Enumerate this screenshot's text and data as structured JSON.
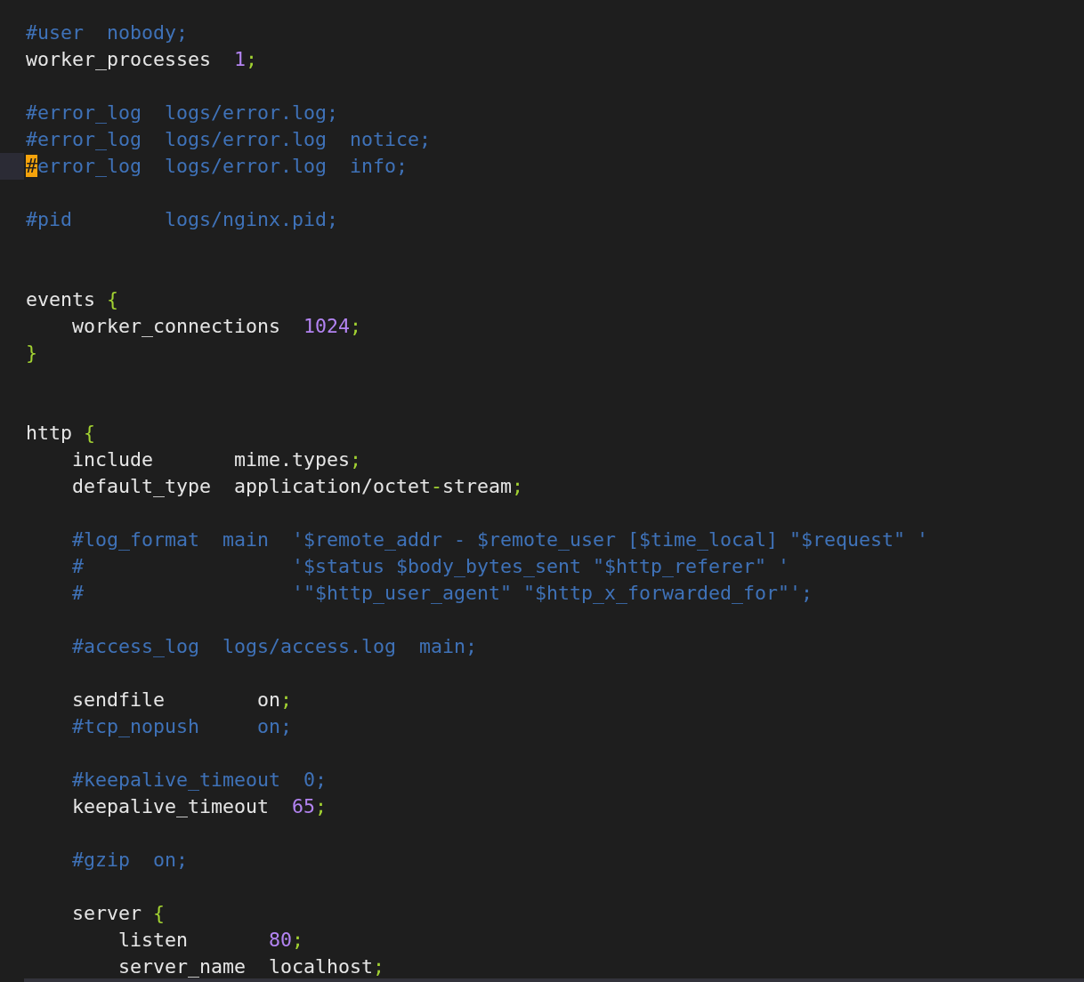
{
  "editor": {
    "lines": [
      {
        "current": false,
        "segments": [
          {
            "kind": "comment",
            "text": "#user  nobody;"
          }
        ]
      },
      {
        "current": false,
        "segments": [
          {
            "kind": "plain",
            "text": "worker_processes  "
          },
          {
            "kind": "number",
            "text": "1"
          },
          {
            "kind": "punct",
            "text": ";"
          }
        ]
      },
      {
        "current": false
      },
      {
        "current": false,
        "segments": [
          {
            "kind": "comment",
            "text": "#error_log  logs/error.log;"
          }
        ]
      },
      {
        "current": false,
        "segments": [
          {
            "kind": "comment",
            "text": "#error_log  logs/error.log  notice;"
          }
        ]
      },
      {
        "current": true,
        "segments": [
          {
            "kind": "cursor",
            "text": "#"
          },
          {
            "kind": "comment",
            "text": "error_log  logs/error.log  info;"
          }
        ]
      },
      {
        "current": false
      },
      {
        "current": false,
        "segments": [
          {
            "kind": "comment",
            "text": "#pid        logs/nginx.pid;"
          }
        ]
      },
      {
        "current": false
      },
      {
        "current": false
      },
      {
        "current": false,
        "segments": [
          {
            "kind": "plain",
            "text": "events "
          },
          {
            "kind": "punct",
            "text": "{"
          }
        ]
      },
      {
        "current": false,
        "segments": [
          {
            "kind": "plain",
            "text": "    worker_connections  "
          },
          {
            "kind": "number",
            "text": "1024"
          },
          {
            "kind": "punct",
            "text": ";"
          }
        ]
      },
      {
        "current": false,
        "segments": [
          {
            "kind": "punct",
            "text": "}"
          }
        ]
      },
      {
        "current": false
      },
      {
        "current": false
      },
      {
        "current": false,
        "segments": [
          {
            "kind": "plain",
            "text": "http "
          },
          {
            "kind": "punct",
            "text": "{"
          }
        ]
      },
      {
        "current": false,
        "segments": [
          {
            "kind": "plain",
            "text": "    include       mime.types"
          },
          {
            "kind": "punct",
            "text": ";"
          }
        ]
      },
      {
        "current": false,
        "segments": [
          {
            "kind": "plain",
            "text": "    default_type  application/octet"
          },
          {
            "kind": "punct",
            "text": "-"
          },
          {
            "kind": "plain",
            "text": "stream"
          },
          {
            "kind": "punct",
            "text": ";"
          }
        ]
      },
      {
        "current": false
      },
      {
        "current": false,
        "segments": [
          {
            "kind": "comment",
            "text": "    #log_format  main  '$remote_addr - $remote_user [$time_local] \"$request\" '"
          }
        ]
      },
      {
        "current": false,
        "segments": [
          {
            "kind": "comment",
            "text": "    #                  '$status $body_bytes_sent \"$http_referer\" '"
          }
        ]
      },
      {
        "current": false,
        "segments": [
          {
            "kind": "comment",
            "text": "    #                  '\"$http_user_agent\" \"$http_x_forwarded_for\"';"
          }
        ]
      },
      {
        "current": false
      },
      {
        "current": false,
        "segments": [
          {
            "kind": "comment",
            "text": "    #access_log  logs/access.log  main;"
          }
        ]
      },
      {
        "current": false
      },
      {
        "current": false,
        "segments": [
          {
            "kind": "plain",
            "text": "    sendfile        on"
          },
          {
            "kind": "punct",
            "text": ";"
          }
        ]
      },
      {
        "current": false,
        "segments": [
          {
            "kind": "comment",
            "text": "    #tcp_nopush     on;"
          }
        ]
      },
      {
        "current": false
      },
      {
        "current": false,
        "segments": [
          {
            "kind": "comment",
            "text": "    #keepalive_timeout  0;"
          }
        ]
      },
      {
        "current": false,
        "segments": [
          {
            "kind": "plain",
            "text": "    keepalive_timeout  "
          },
          {
            "kind": "number",
            "text": "65"
          },
          {
            "kind": "punct",
            "text": ";"
          }
        ]
      },
      {
        "current": false
      },
      {
        "current": false,
        "segments": [
          {
            "kind": "comment",
            "text": "    #gzip  on;"
          }
        ]
      },
      {
        "current": false
      },
      {
        "current": false,
        "segments": [
          {
            "kind": "plain",
            "text": "    server "
          },
          {
            "kind": "punct",
            "text": "{"
          }
        ]
      },
      {
        "current": false,
        "segments": [
          {
            "kind": "plain",
            "text": "        listen       "
          },
          {
            "kind": "number",
            "text": "80"
          },
          {
            "kind": "punct",
            "text": ";"
          }
        ]
      },
      {
        "current": false,
        "segments": [
          {
            "kind": "plain",
            "text": "        server_name  localhost"
          },
          {
            "kind": "punct",
            "text": ";"
          }
        ]
      }
    ]
  }
}
